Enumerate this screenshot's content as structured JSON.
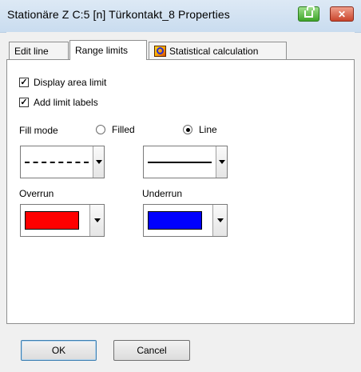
{
  "window": {
    "title": "Stationäre Z C:5 [n] Türkontakt_8 Properties",
    "help_icon": "help-icon",
    "close_label": "✕"
  },
  "tabs": [
    {
      "label": "Edit line",
      "active": false
    },
    {
      "label": "Range limits",
      "active": true
    },
    {
      "label": "Statistical calculation",
      "active": false,
      "icon": "statistical-calculation-icon"
    }
  ],
  "range_limits": {
    "display_area_limit": {
      "label": "Display area limit",
      "checked": true
    },
    "add_limit_labels": {
      "label": "Add limit labels",
      "checked": true
    },
    "fill_mode_label": "Fill mode",
    "fill_mode_options": [
      {
        "label": "Filled",
        "selected": false
      },
      {
        "label": "Line",
        "selected": true
      }
    ],
    "line_style_left": "dash-dot",
    "line_style_right": "solid",
    "overrun_label": "Overrun",
    "underrun_label": "Underrun",
    "overrun_color": "#ff0000",
    "underrun_color": "#0000ff"
  },
  "buttons": {
    "ok": "OK",
    "cancel": "Cancel"
  },
  "check_glyph": "✓"
}
